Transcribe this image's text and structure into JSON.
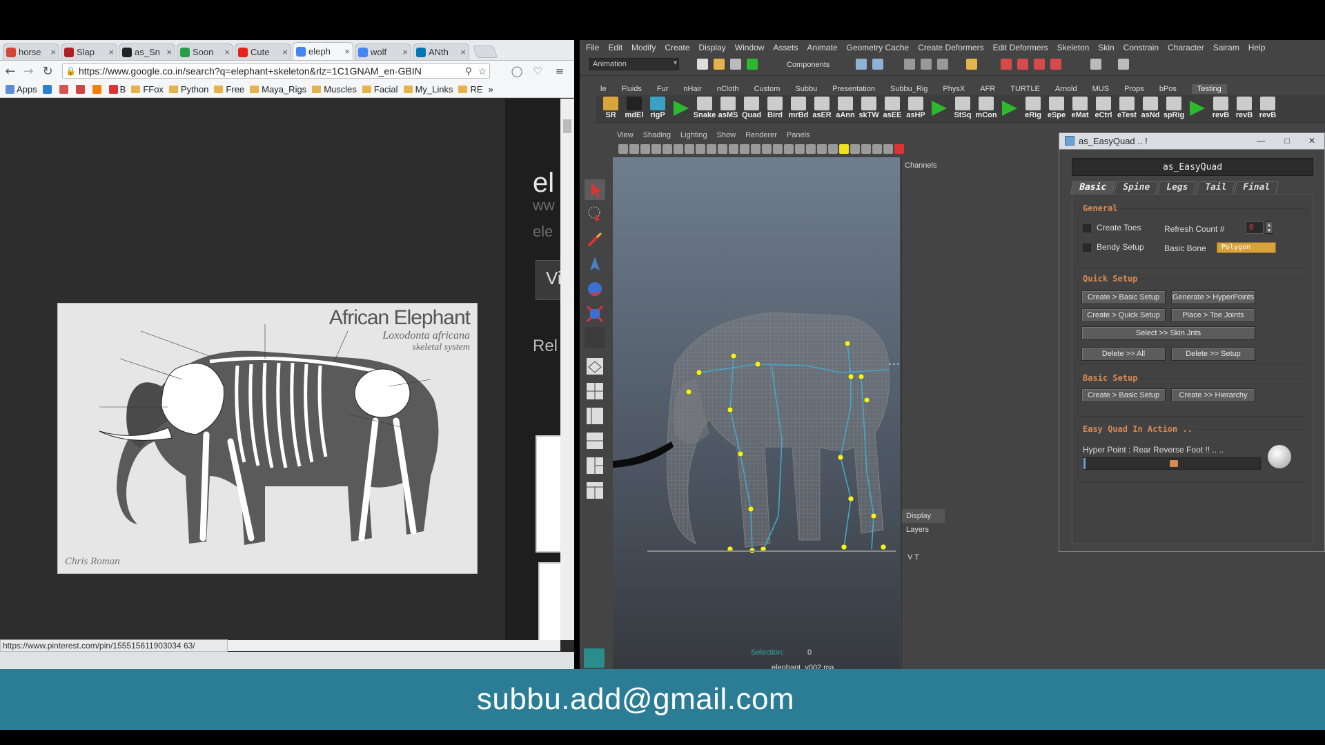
{
  "chrome": {
    "tabs": [
      {
        "label": "horse",
        "icon": "gmail-icon",
        "color": "#d44638"
      },
      {
        "label": "Slap",
        "icon": "cg-icon",
        "color": "#b11f24"
      },
      {
        "label": "as_Sn",
        "icon": "h-icon",
        "color": "#222222"
      },
      {
        "label": "Soon",
        "icon": "pk-icon",
        "color": "#2a9d4a"
      },
      {
        "label": "Cute",
        "icon": "youtube-icon",
        "color": "#e62117"
      },
      {
        "label": "eleph",
        "icon": "google-icon",
        "color": "#4285f4"
      },
      {
        "label": "wolf",
        "icon": "google-icon",
        "color": "#4285f4"
      },
      {
        "label": "ANth",
        "icon": "linkedin-icon",
        "color": "#0077b5"
      }
    ],
    "close_glyph": "×",
    "url": "https://www.google.co.in/search?q=elephant+skeleton&rlz=1C1GNAM_en-GBIN",
    "bookmarks": [
      {
        "label": "Apps",
        "type": "apps"
      },
      {
        "label": "",
        "type": "w"
      },
      {
        "label": "",
        "type": "share"
      },
      {
        "label": "",
        "type": "mail"
      },
      {
        "label": "",
        "type": "blogger"
      },
      {
        "label": "B",
        "type": "b"
      },
      {
        "label": "FFox",
        "type": "folder"
      },
      {
        "label": "Python",
        "type": "folder"
      },
      {
        "label": "Free",
        "type": "folder"
      },
      {
        "label": "Maya_Rigs",
        "type": "folder"
      },
      {
        "label": "Muscles",
        "type": "folder"
      },
      {
        "label": "Facial",
        "type": "folder"
      },
      {
        "label": "My_Links",
        "type": "folder"
      },
      {
        "label": "RE",
        "type": "folder"
      }
    ],
    "more_bookmarks": "»",
    "result_title": "el",
    "result_url": "ww",
    "result_sub": "ele",
    "visit_label": "Vi",
    "related_label": "Rel",
    "hero": {
      "title": "African Elephant",
      "subtitle": "Loxodonta africana",
      "subtitle2": "skeletal system",
      "credit": "Chris Roman"
    },
    "status_url": "https://www.pinterest.com/pin/155515611903034 63/"
  },
  "maya": {
    "menus": [
      "File",
      "Edit",
      "Modify",
      "Create",
      "Display",
      "Window",
      "Assets",
      "Animate",
      "Geometry Cache",
      "Create Deformers",
      "Edit Deformers",
      "Skeleton",
      "Skin",
      "Constrain",
      "Character",
      "Sairam",
      "Help"
    ],
    "mode": "Animation",
    "components_label": "Components",
    "shelf_tabs": [
      "le",
      "Fluids",
      "Fur",
      "nHair",
      "nCloth",
      "Custom",
      "Subbu",
      "Presentation",
      "Subbu_Rig",
      "PhysX",
      "AFR",
      "TURTLE",
      "Arnold",
      "MUS",
      "Props",
      "bPos",
      "Testing"
    ],
    "active_shelf": "Testing",
    "shelf_items": [
      "SR",
      "mdEl",
      "rigP",
      "",
      "Snake",
      "asMS",
      "Quad",
      "Bird",
      "mrBd",
      "asER",
      "aAnn",
      "skTW",
      "asEE",
      "asHP",
      "",
      "StSq",
      "mCon",
      "",
      "eRig",
      "eSpe",
      "eMat",
      "eCtrl",
      "eTest",
      "asNd",
      "spRig",
      "",
      "revB",
      "revB",
      "revB"
    ],
    "panel_menus": [
      "View",
      "Shading",
      "Lighting",
      "Show",
      "Renderer",
      "Panels"
    ],
    "selection_label": "Selection:",
    "selection_value": "0",
    "scene_file": "elephant_v002.ma",
    "channels_label": "Channels",
    "display_label": "Display",
    "layers_label": "Layers",
    "vt_label": "V   T"
  },
  "easyquad": {
    "window_title": "as_EasyQuad .. !",
    "header": "as_EasyQuad",
    "tabs": [
      "Basic",
      "Spine",
      "Legs",
      "Tail",
      "Final"
    ],
    "active_tab": "Basic",
    "general_title": "General",
    "create_toes": "Create Toes",
    "bendy_setup": "Bendy Setup",
    "refresh_count_label": "Refresh Count #",
    "refresh_count_value": "0",
    "basic_bone_label": "Basic Bone",
    "basic_bone_value": "Polygon",
    "quick_setup_title": "Quick Setup",
    "btn_create_basic": "Create > Basic Setup",
    "btn_gen_hyper": "Generate > HyperPoints",
    "btn_create_quick": "Create > Quick Setup",
    "btn_place_toe": "Place > Toe Joints",
    "btn_select_skin": "Select >> Skin Jnts",
    "btn_delete_all": "Delete >> All",
    "btn_delete_setup": "Delete >> Setup",
    "basic_setup_title": "Basic Setup",
    "btn_create_basic2": "Create > Basic Setup",
    "btn_create_hier": "Create >> Hierarchy",
    "in_action_title": "Easy Quad In Action ..",
    "hyper_point_text": "Hyper Point : Rear Reverse Foot !! .. ..",
    "progress": 0.01,
    "accent": "#d98a54"
  },
  "footer": {
    "email": "subbu.add@gmail.com",
    "color": "#2b7d96"
  }
}
